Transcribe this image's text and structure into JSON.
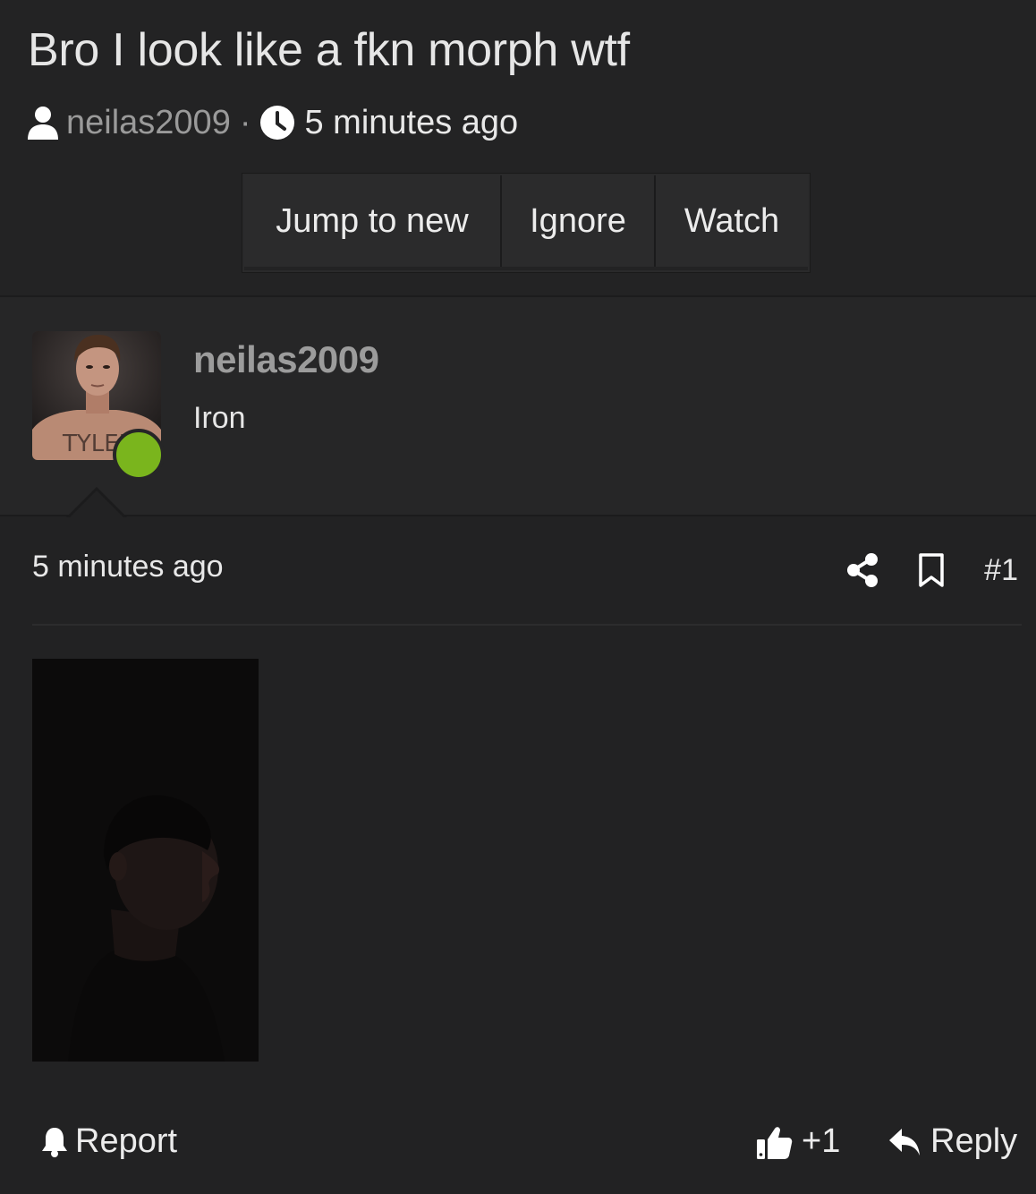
{
  "thread": {
    "title": "Bro I look like a fkn morph wtf",
    "author": "neilas2009",
    "separator": "·",
    "time": "5 minutes ago"
  },
  "actions": {
    "jump_to_new": "Jump to new",
    "ignore": "Ignore",
    "watch": "Watch"
  },
  "post": {
    "author_name": "neilas2009",
    "author_title": "Iron",
    "time": "5 minutes ago",
    "number": "#1",
    "avatar_caption": "TYLER"
  },
  "footer": {
    "report": "Report",
    "like_count": "+1",
    "reply": "Reply"
  },
  "colors": {
    "background": "#222223",
    "online_status": "#7ab51d",
    "muted_text": "#9a9a9a"
  },
  "icons": [
    "user-icon",
    "clock-icon",
    "share-icon",
    "bookmark-icon",
    "bell-icon",
    "thumbs-up-icon",
    "reply-icon"
  ]
}
